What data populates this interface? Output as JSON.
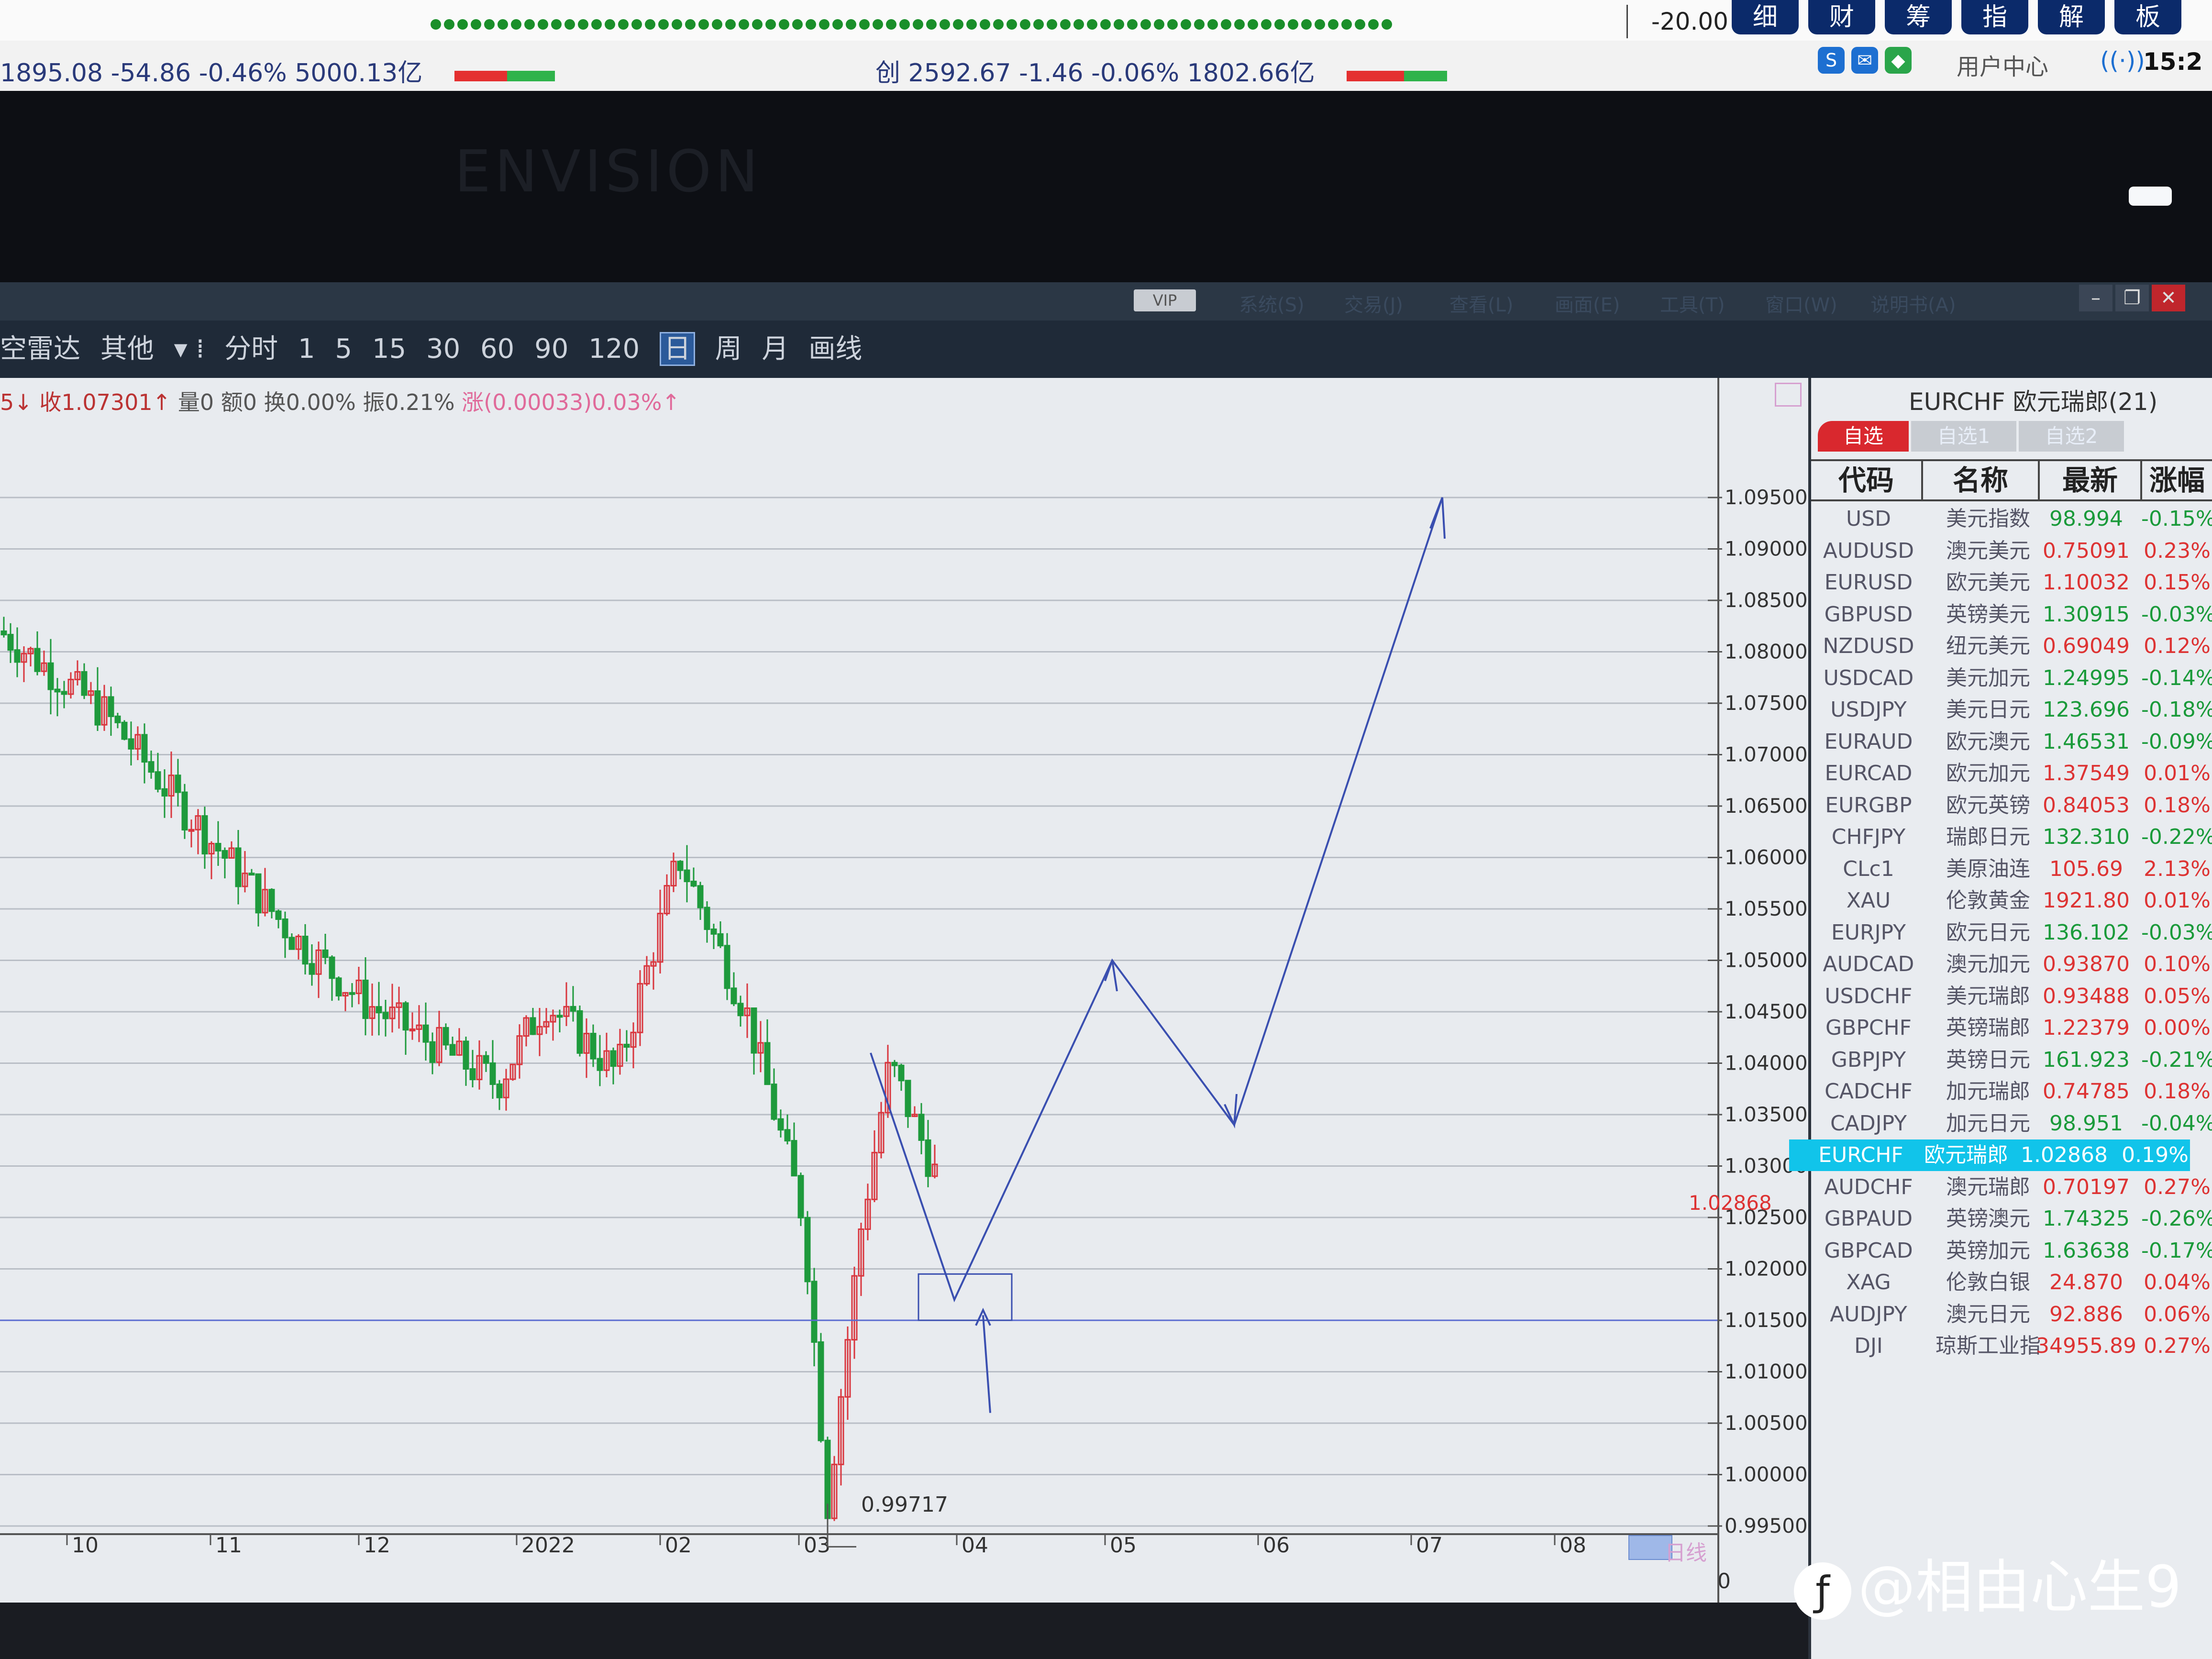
{
  "top_strip": {
    "value_right": "-20.00",
    "tabs": [
      "细",
      "财",
      "筹",
      "指",
      "解",
      "板"
    ],
    "index_left": "1895.08  -54.86  -0.46%  5000.13亿",
    "index_mid": "创  2592.67  -1.46  -0.06%  1802.66亿",
    "user_center": "用户中心",
    "clock": "15:2"
  },
  "bezel": {
    "brand": "ENVISION"
  },
  "menubar": {
    "vip": "VIP",
    "items": [
      "系统(S)",
      "交易(J)",
      "查看(L)",
      "画面(E)",
      "工具(T)",
      "窗口(W)",
      "说明书(A)"
    ]
  },
  "toolbar": {
    "items": [
      "空雷达",
      "其他",
      "分时",
      "1",
      "5",
      "15",
      "30",
      "60",
      "90",
      "120",
      "日",
      "周",
      "月",
      "画线"
    ]
  },
  "chart_info": {
    "close": "5↓ 收1.07301↑",
    "volume": "量0",
    "amount": "额0",
    "turnover": "换0.00%",
    "amplitude": "振0.21%",
    "change": "涨(0.00033)0.03%↑"
  },
  "chart": {
    "last_price": "1.02868",
    "low_label": "0.99717",
    "day_line": "日线",
    "zero": "0"
  },
  "chart_data": {
    "type": "candlestick",
    "symbol": "EURCHF",
    "y_ticks": [
      "1.09500",
      "1.09000",
      "1.08500",
      "1.08000",
      "1.07500",
      "1.07000",
      "1.06500",
      "1.06000",
      "1.05500",
      "1.05000",
      "1.04500",
      "1.04000",
      "1.03500",
      "1.03000",
      "1.02500",
      "1.02000",
      "1.01500",
      "1.01000",
      "1.00500",
      "1.00000",
      "0.99500"
    ],
    "x_ticks": [
      "10",
      "11",
      "12",
      "2022",
      "02",
      "03",
      "04",
      "05",
      "06",
      "07",
      "08"
    ],
    "ylim": [
      0.995,
      1.095
    ],
    "approx_path": [
      {
        "x": "10",
        "y": 1.082
      },
      {
        "x": "10-mid",
        "y": 1.074
      },
      {
        "x": "11",
        "y": 1.066
      },
      {
        "x": "11-end",
        "y": 1.052
      },
      {
        "x": "12",
        "y": 1.046
      },
      {
        "x": "12-end",
        "y": 1.038
      },
      {
        "x": "2022",
        "y": 1.046
      },
      {
        "x": "2022-mid",
        "y": 1.039
      },
      {
        "x": "02",
        "y": 1.06
      },
      {
        "x": "02-mid",
        "y": 1.045
      },
      {
        "x": "03",
        "y": 1.025
      },
      {
        "x": "03-low",
        "y": 0.99717
      },
      {
        "x": "03-mid",
        "y": 1.024
      },
      {
        "x": "03-late",
        "y": 1.04
      },
      {
        "x": "04",
        "y": 1.02868
      }
    ],
    "projection_arrows": [
      {
        "x": "04",
        "y": 1.017
      },
      {
        "x": "05",
        "y": 1.05
      },
      {
        "x": "06",
        "y": 1.034
      },
      {
        "x": "07",
        "y": 1.095
      }
    ]
  },
  "quote_panel": {
    "title": "EURCHF 欧元瑞郎(21)",
    "tabs": [
      "自选",
      "自选1",
      "自选2"
    ],
    "headers": [
      "代码",
      "名称",
      "最新",
      "涨幅"
    ],
    "rows": [
      {
        "code": "USD",
        "name": "美元指数",
        "last": "98.994",
        "chg": "-0.15%",
        "dir": "dn"
      },
      {
        "code": "AUDUSD",
        "name": "澳元美元",
        "last": "0.75091",
        "chg": "0.23%",
        "dir": "up"
      },
      {
        "code": "EURUSD",
        "name": "欧元美元",
        "last": "1.10032",
        "chg": "0.15%",
        "dir": "up"
      },
      {
        "code": "GBPUSD",
        "name": "英镑美元",
        "last": "1.30915",
        "chg": "-0.03%",
        "dir": "dn"
      },
      {
        "code": "NZDUSD",
        "name": "纽元美元",
        "last": "0.69049",
        "chg": "0.12%",
        "dir": "up"
      },
      {
        "code": "USDCAD",
        "name": "美元加元",
        "last": "1.24995",
        "chg": "-0.14%",
        "dir": "dn"
      },
      {
        "code": "USDJPY",
        "name": "美元日元",
        "last": "123.696",
        "chg": "-0.18%",
        "dir": "dn"
      },
      {
        "code": "EURAUD",
        "name": "欧元澳元",
        "last": "1.46531",
        "chg": "-0.09%",
        "dir": "dn"
      },
      {
        "code": "EURCAD",
        "name": "欧元加元",
        "last": "1.37549",
        "chg": "0.01%",
        "dir": "up"
      },
      {
        "code": "EURGBP",
        "name": "欧元英镑",
        "last": "0.84053",
        "chg": "0.18%",
        "dir": "up"
      },
      {
        "code": "CHFJPY",
        "name": "瑞郎日元",
        "last": "132.310",
        "chg": "-0.22%",
        "dir": "dn"
      },
      {
        "code": "CLc1",
        "name": "美原油连",
        "last": "105.69",
        "chg": "2.13%",
        "dir": "up"
      },
      {
        "code": "XAU",
        "name": "伦敦黄金",
        "last": "1921.80",
        "chg": "0.01%",
        "dir": "up"
      },
      {
        "code": "EURJPY",
        "name": "欧元日元",
        "last": "136.102",
        "chg": "-0.03%",
        "dir": "dn"
      },
      {
        "code": "AUDCAD",
        "name": "澳元加元",
        "last": "0.93870",
        "chg": "0.10%",
        "dir": "up"
      },
      {
        "code": "USDCHF",
        "name": "美元瑞郎",
        "last": "0.93488",
        "chg": "0.05%",
        "dir": "up"
      },
      {
        "code": "GBPCHF",
        "name": "英镑瑞郎",
        "last": "1.22379",
        "chg": "0.00%",
        "dir": "up"
      },
      {
        "code": "GBPJPY",
        "name": "英镑日元",
        "last": "161.923",
        "chg": "-0.21%",
        "dir": "dn"
      },
      {
        "code": "CADCHF",
        "name": "加元瑞郎",
        "last": "0.74785",
        "chg": "0.18%",
        "dir": "up"
      },
      {
        "code": "CADJPY",
        "name": "加元日元",
        "last": "98.951",
        "chg": "-0.04%",
        "dir": "dn"
      },
      {
        "code": "EURCHF",
        "name": "欧元瑞郎",
        "last": "1.02868",
        "chg": "0.19%",
        "dir": "up",
        "selected": true
      },
      {
        "code": "AUDCHF",
        "name": "澳元瑞郎",
        "last": "0.70197",
        "chg": "0.27%",
        "dir": "up"
      },
      {
        "code": "GBPAUD",
        "name": "英镑澳元",
        "last": "1.74325",
        "chg": "-0.26%",
        "dir": "dn"
      },
      {
        "code": "GBPCAD",
        "name": "英镑加元",
        "last": "1.63638",
        "chg": "-0.17%",
        "dir": "dn"
      },
      {
        "code": "XAG",
        "name": "伦敦白银",
        "last": "24.870",
        "chg": "0.04%",
        "dir": "up"
      },
      {
        "code": "AUDJPY",
        "name": "澳元日元",
        "last": "92.886",
        "chg": "0.06%",
        "dir": "up"
      },
      {
        "code": "DJI",
        "name": "琼斯工业指",
        "last": "34955.89",
        "chg": "0.27%",
        "dir": "up"
      }
    ]
  },
  "watermark": {
    "text": "@相由心生9"
  },
  "colors": {
    "up": "#d33333",
    "down": "#1a9a3a",
    "selected": "#11c4ea",
    "arrow": "#3a4fb0"
  }
}
